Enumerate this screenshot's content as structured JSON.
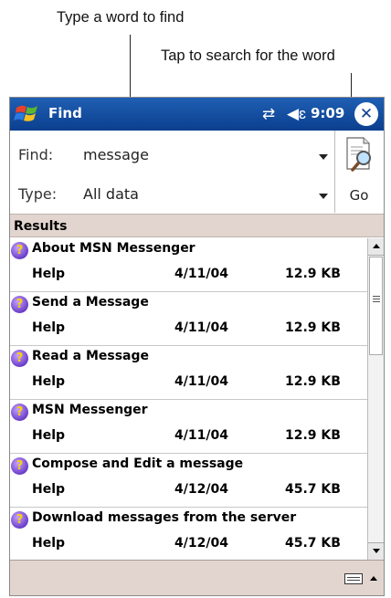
{
  "callouts": {
    "type_word": "Type a word to find",
    "tap_search": "Tap to search for the word"
  },
  "titlebar": {
    "title": "Find",
    "time": "9:09",
    "close_label": "✕",
    "start_icon": "windows-flag-icon",
    "connectivity_icon": "connectivity-icon",
    "volume_icon": "volume-icon"
  },
  "search": {
    "find_label": "Find:",
    "find_value": "message",
    "type_label": "Type:",
    "type_value": "All data",
    "go_label": "Go"
  },
  "results": {
    "header": "Results",
    "items": [
      {
        "title": "About MSN Messenger",
        "type": "Help",
        "date": "4/11/04",
        "size": "12.9 KB"
      },
      {
        "title": "Send a Message",
        "type": "Help",
        "date": "4/11/04",
        "size": "12.9 KB"
      },
      {
        "title": "Read a Message",
        "type": "Help",
        "date": "4/11/04",
        "size": "12.9 KB"
      },
      {
        "title": "MSN Messenger",
        "type": "Help",
        "date": "4/11/04",
        "size": "12.9 KB"
      },
      {
        "title": "Compose and Edit a message",
        "type": "Help",
        "date": "4/12/04",
        "size": "45.7 KB"
      },
      {
        "title": "Download messages from the server",
        "type": "Help",
        "date": "4/12/04",
        "size": "45.7 KB"
      }
    ]
  },
  "colors": {
    "titlebar": "#0b3f8f",
    "header_band": "#e2d5cf",
    "help_icon": "#6b3ec9"
  }
}
